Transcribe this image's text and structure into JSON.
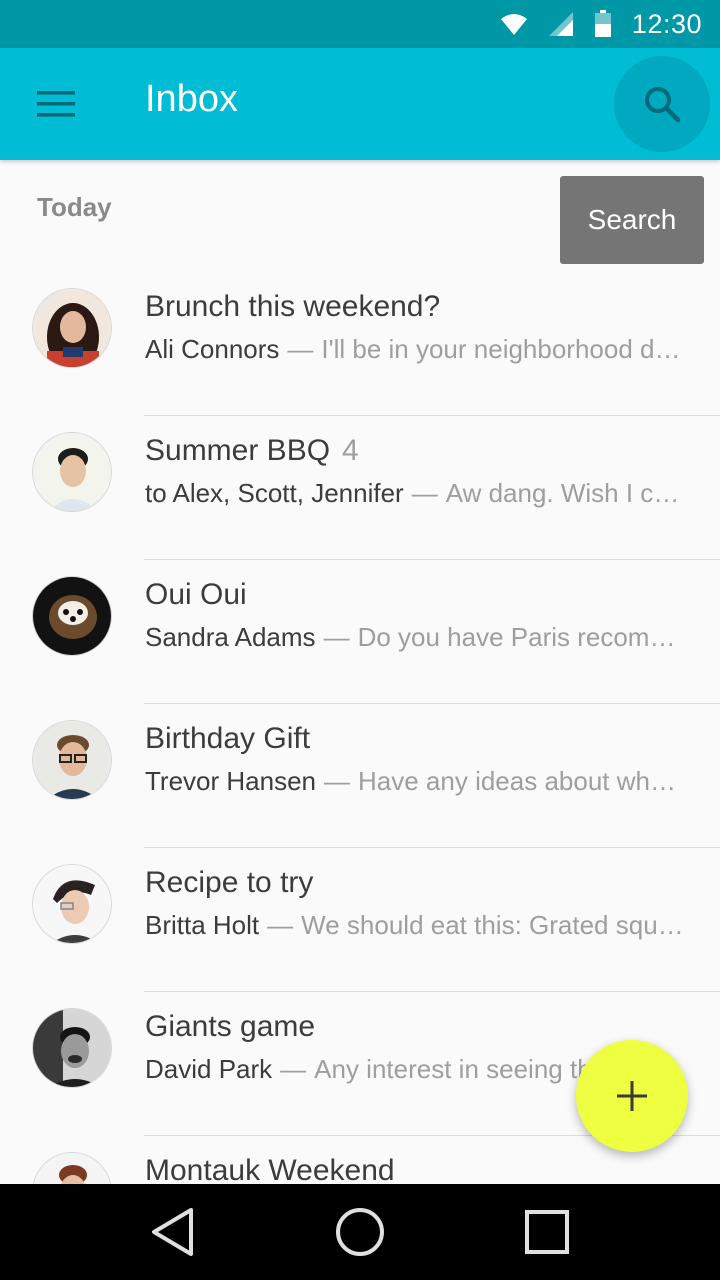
{
  "status_bar": {
    "time": "12:30",
    "icons": [
      "wifi-icon",
      "signal-icon",
      "battery-icon"
    ]
  },
  "app_bar": {
    "title": "Inbox",
    "menu_icon": "hamburger-menu-icon",
    "search_icon": "search-icon",
    "color": "#00bcd4"
  },
  "tooltip": {
    "label": "Search"
  },
  "section": {
    "header": "Today"
  },
  "mails": [
    {
      "subject": "Brunch this weekend?",
      "count": "",
      "sender": "Ali Connors",
      "snippet": "I'll be in your neighborhood doing errands this weekend."
    },
    {
      "subject": "Summer BBQ",
      "count": "4",
      "sender": "to Alex, Scott, Jennifer",
      "snippet": "Aw dang. Wish I could make it."
    },
    {
      "subject": "Oui Oui",
      "count": "",
      "sender": "Sandra Adams",
      "snippet": "Do you have Paris recommendations?"
    },
    {
      "subject": "Birthday Gift",
      "count": "",
      "sender": "Trevor Hansen",
      "snippet": "Have any ideas about what we should get Heidi?"
    },
    {
      "subject": "Recipe to try",
      "count": "",
      "sender": "Britta Holt",
      "snippet": "We should eat this: Grated squash, corn and tomatillo tacos."
    },
    {
      "subject": "Giants game",
      "count": "",
      "sender": "David Park",
      "snippet": "Any interest in seeing the game?"
    },
    {
      "subject": "Montauk Weekend",
      "count": "",
      "sender": "",
      "snippet": ""
    }
  ],
  "fab": {
    "icon": "plus-icon",
    "color": "#eeff41"
  },
  "nav_bar": {
    "icons": [
      "back-icon",
      "home-icon",
      "recents-icon"
    ]
  }
}
